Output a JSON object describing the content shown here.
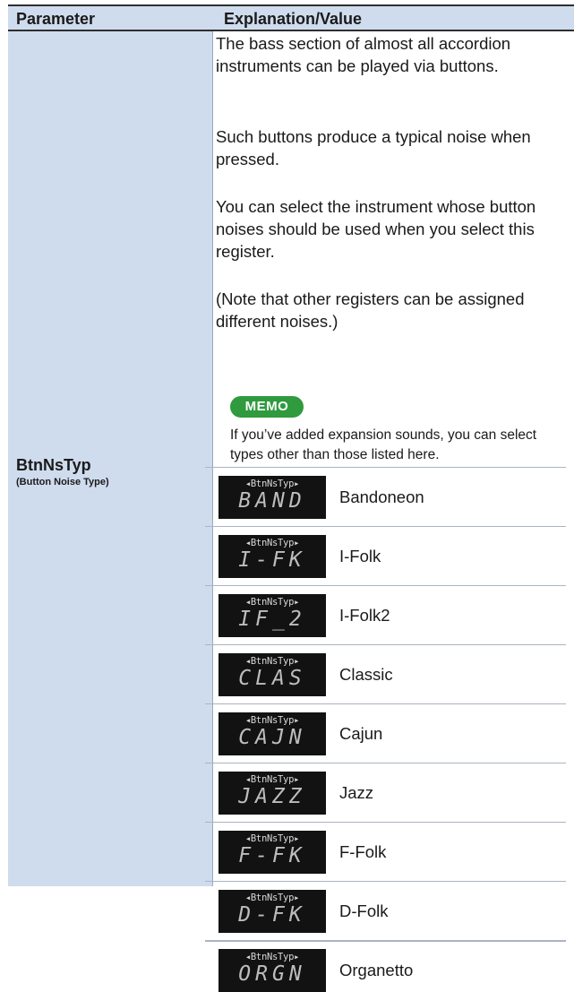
{
  "header": {
    "parameter": "Parameter",
    "explanation": "Explanation/Value"
  },
  "parameter": {
    "name": "BtnNsTyp",
    "full_name": "(Button Noise Type)"
  },
  "description": [
    "The bass section of almost all accordion instruments can be played via buttons.",
    "Such buttons produce a typical noise when pressed.",
    "You can select the instrument whose button noises should be used when you select this register.",
    "(Note that other registers can be assigned different noises.)"
  ],
  "memo": {
    "badge": "MEMO",
    "text": "If you’ve added expansion sounds, you can select types other than those listed here."
  },
  "lcd_title": "◂BtnNsTyp▸",
  "options": [
    {
      "display": "BAND",
      "label": "Bandoneon"
    },
    {
      "display": "I-FK",
      "label": "I-Folk"
    },
    {
      "display": "IF_2",
      "label": "I-Folk2"
    },
    {
      "display": "CLAS",
      "label": "Classic"
    },
    {
      "display": "CAJN",
      "label": "Cajun"
    },
    {
      "display": "JAZZ",
      "label": "Jazz"
    },
    {
      "display": "F-FK",
      "label": "F-Folk"
    },
    {
      "display": "D-FK",
      "label": "D-Folk"
    },
    {
      "display": "ORGN",
      "label": "Organetto"
    }
  ]
}
